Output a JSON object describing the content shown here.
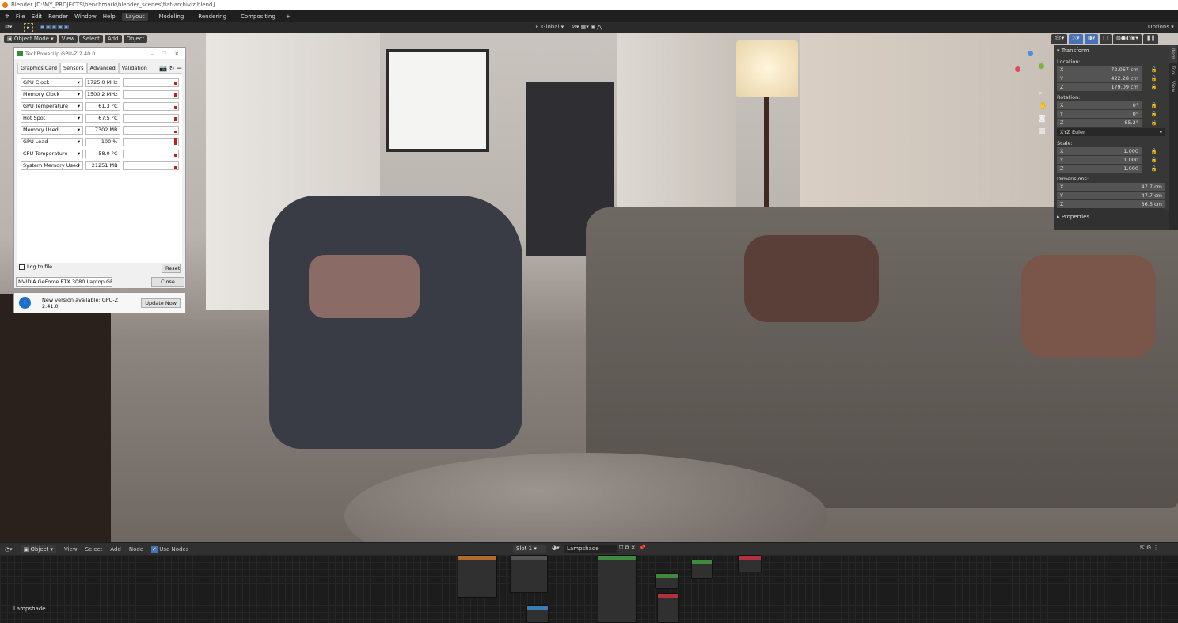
{
  "window_title": "Blender [D:\\MY_PROJECTS\\benchmark\\blender_scenes\\flat-archiviz.blend]",
  "menu": [
    "File",
    "Edit",
    "Render",
    "Window",
    "Help"
  ],
  "workspaces": [
    {
      "label": "Layout",
      "active": true
    },
    {
      "label": "Modeling"
    },
    {
      "label": "Rendering"
    },
    {
      "label": "Compositing"
    }
  ],
  "add_workspace": "+",
  "tool_header": {
    "orientation": "Global",
    "options": "Options"
  },
  "viewport_header": {
    "mode": "Object Mode",
    "items": [
      "View",
      "Select",
      "Add",
      "Object"
    ]
  },
  "gpuz": {
    "title": "TechPowerUp GPU-Z 2.40.0",
    "tabs": [
      {
        "label": "Graphics Card"
      },
      {
        "label": "Sensors",
        "active": true
      },
      {
        "label": "Advanced"
      },
      {
        "label": "Validation"
      }
    ],
    "sensors": [
      {
        "name": "GPU Clock",
        "value": "1725.0 MHz",
        "level": 0.5
      },
      {
        "name": "Memory Clock",
        "value": "1500.2 MHz",
        "level": 0.5
      },
      {
        "name": "GPU Temperature",
        "value": "61.3 °C",
        "level": 0.45
      },
      {
        "name": "Hot Spot",
        "value": "67.5 °C",
        "level": 0.5
      },
      {
        "name": "Memory Used",
        "value": "7302 MB",
        "level": 0.35
      },
      {
        "name": "GPU Load",
        "value": "100 %",
        "level": 1.0
      },
      {
        "name": "CPU Temperature",
        "value": "58.0 °C",
        "level": 0.4
      },
      {
        "name": "System Memory Used",
        "value": "21251 MB",
        "level": 0.3
      }
    ],
    "log_to_file": "Log to file",
    "reset": "Reset",
    "gpu_select": "NVIDIA GeForce RTX 3080 Laptop GPU",
    "close": "Close",
    "update_msg": "New version available: GPU-Z 2.41.0",
    "update_btn": "Update Now",
    "accent": "#c0201c"
  },
  "npanel": {
    "transform": "Transform",
    "location_label": "Location:",
    "location": [
      {
        "axis": "X",
        "value": "72.067 cm"
      },
      {
        "axis": "Y",
        "value": "422.28 cm"
      },
      {
        "axis": "Z",
        "value": "179.09 cm"
      }
    ],
    "rotation_label": "Rotation:",
    "rotation": [
      {
        "axis": "X",
        "value": "0°"
      },
      {
        "axis": "Y",
        "value": "0°"
      },
      {
        "axis": "Z",
        "value": "85.2°"
      }
    ],
    "rotation_mode": "XYZ Euler",
    "scale_label": "Scale:",
    "scale": [
      {
        "axis": "X",
        "value": "1.000"
      },
      {
        "axis": "Y",
        "value": "1.000"
      },
      {
        "axis": "Z",
        "value": "1.000"
      }
    ],
    "dimensions_label": "Dimensions:",
    "dimensions": [
      {
        "axis": "X",
        "value": "47.7 cm"
      },
      {
        "axis": "Y",
        "value": "47.7 cm"
      },
      {
        "axis": "Z",
        "value": "36.5 cm"
      }
    ],
    "properties": "Properties",
    "tabs": [
      "Item",
      "Tool",
      "View"
    ]
  },
  "node_editor": {
    "type": "Object",
    "items": [
      "View",
      "Select",
      "Add",
      "Node"
    ],
    "use_nodes": "Use Nodes",
    "slot": "Slot 1",
    "material": "Lampshade",
    "object_label": "Lampshade"
  }
}
